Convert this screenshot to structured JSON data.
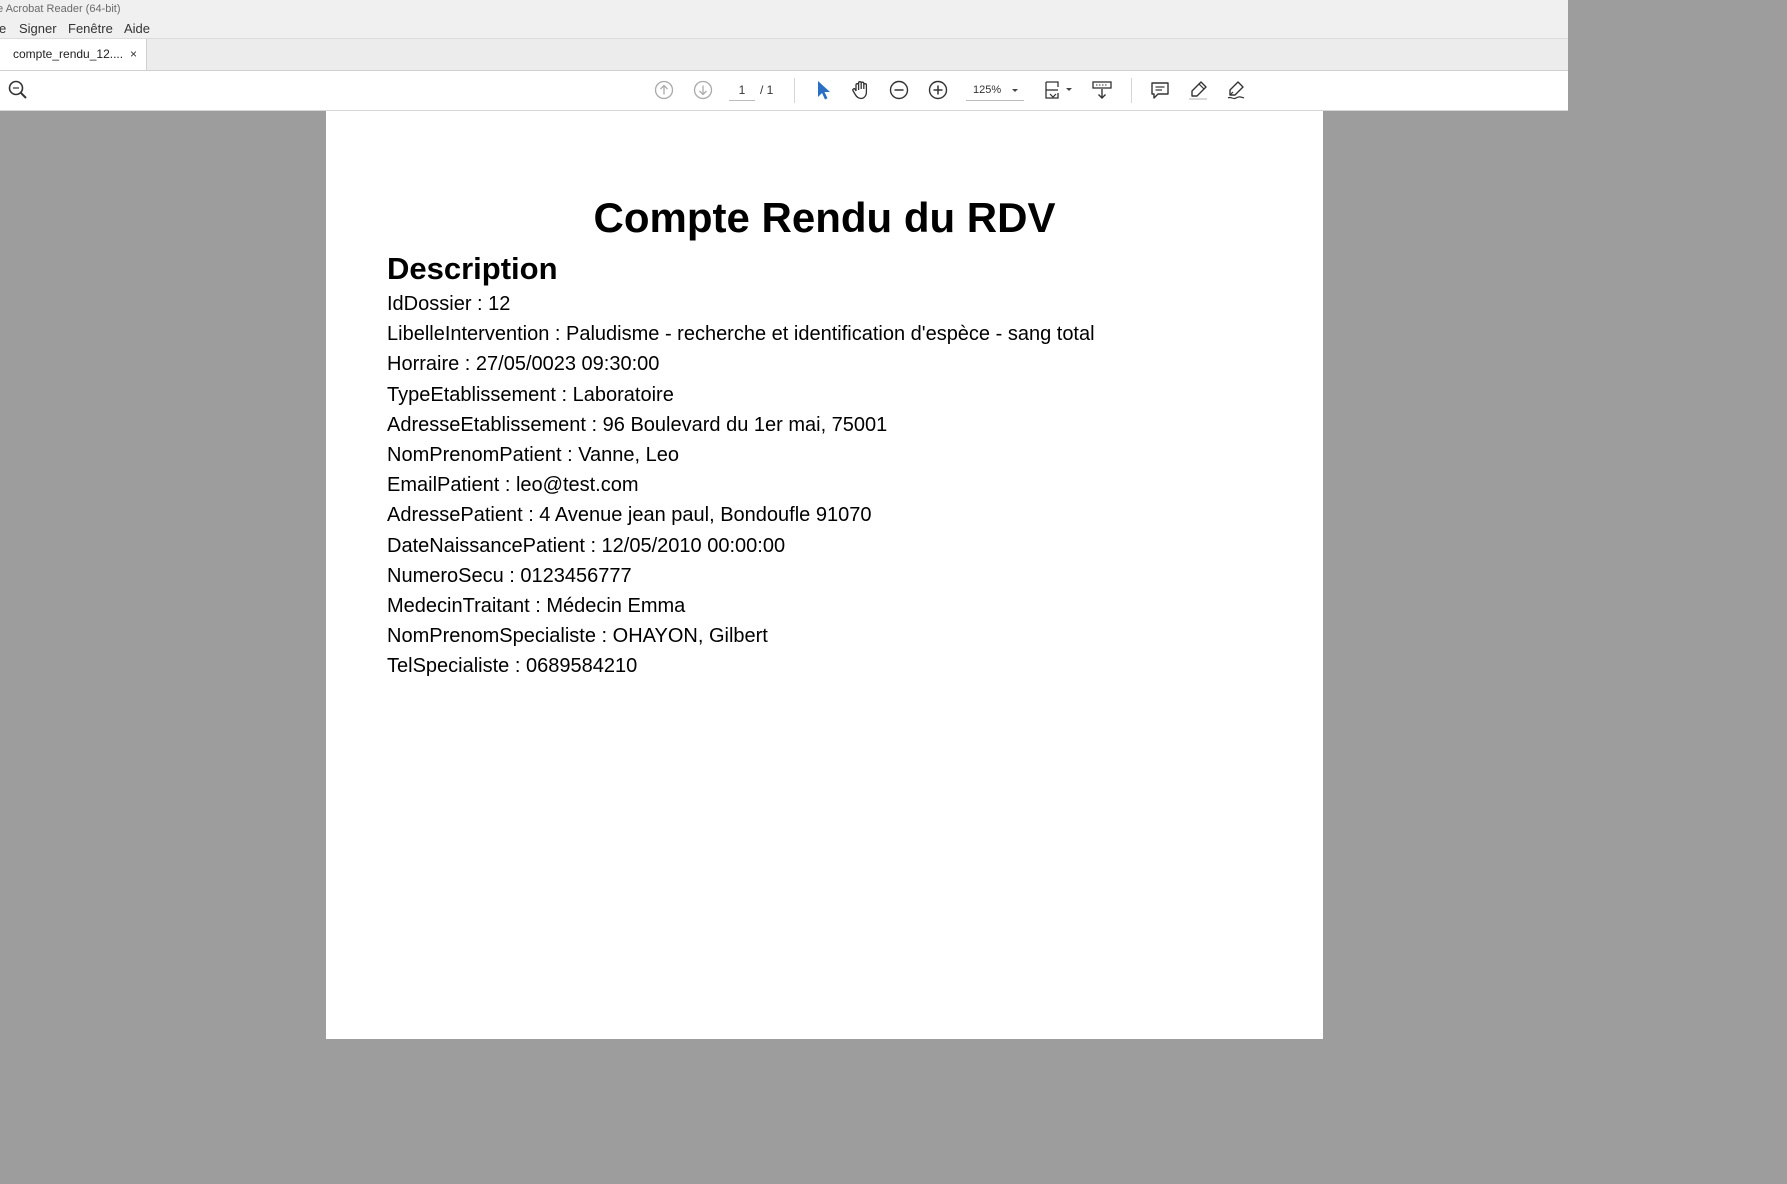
{
  "window": {
    "title": "e Acrobat Reader (64-bit)"
  },
  "menu": {
    "items": [
      "e",
      "Signer",
      "Fenêtre",
      "Aide"
    ]
  },
  "tab": {
    "label": "compte_rendu_12....",
    "close": "×"
  },
  "toolbar": {
    "page_current": "1",
    "page_total": "/ 1",
    "zoom": "125%",
    "icons": [
      "search-zoom-icon",
      "page-up-icon",
      "page-down-icon",
      "select-arrow-icon",
      "hand-icon",
      "zoom-out-icon",
      "zoom-in-icon",
      "fit-page-icon",
      "scroll-mode-icon",
      "comment-icon",
      "highlight-icon",
      "sign-icon"
    ]
  },
  "colors": {
    "accent": "#2b6fc4",
    "toolbar_bg": "#ffffff",
    "workspace_bg": "#9d9d9d"
  },
  "document": {
    "title": "Compte Rendu du RDV",
    "section": "Description",
    "lines": [
      "IdDossier : 12",
      "LibelleIntervention : Paludisme - recherche et identification d'espèce - sang total",
      "Horraire : 27/05/0023 09:30:00",
      "TypeEtablissement : Laboratoire",
      "AdresseEtablissement : 96 Boulevard du 1er mai, 75001",
      "NomPrenomPatient : Vanne, Leo",
      "EmailPatient : leo@test.com",
      "AdressePatient : 4 Avenue jean paul, Bondoufle 91070",
      "DateNaissancePatient : 12/05/2010 00:00:00",
      "NumeroSecu : 0123456777",
      "MedecinTraitant : Médecin Emma",
      "NomPrenomSpecialiste : OHAYON, Gilbert",
      "TelSpecialiste : 0689584210"
    ]
  }
}
